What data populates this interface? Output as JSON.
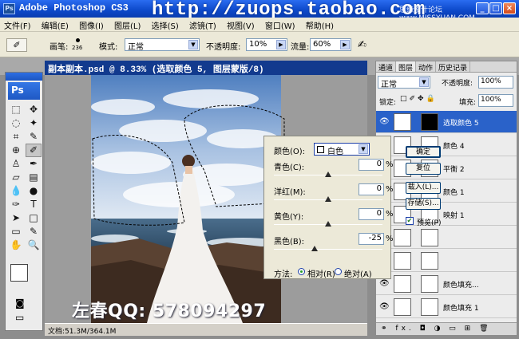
{
  "titlebar": {
    "logo": "Ps",
    "app_title": "Adobe Photoshop CS3",
    "watermark_url": "http://zuops.taobao.com",
    "watermark_small": "思缘设计论坛 www.MISSYUAN.COM",
    "min": "_",
    "max": "□",
    "close": "×"
  },
  "menu": [
    "文件(F)",
    "编辑(E)",
    "图像(I)",
    "图层(L)",
    "选择(S)",
    "滤镜(T)",
    "视图(V)",
    "窗口(W)",
    "帮助(H)"
  ],
  "options": {
    "brush_label": "画笔:",
    "brush_size": "236",
    "mode_label": "模式:",
    "mode_value": "正常",
    "opacity_label": "不透明度:",
    "opacity_value": "10%",
    "flow_label": "流量:",
    "flow_value": "60%"
  },
  "toolbox": {
    "badge": "Ps",
    "tools": [
      {
        "name": "marquee-icon",
        "glyph": "⬚"
      },
      {
        "name": "move-icon",
        "glyph": "✥"
      },
      {
        "name": "lasso-icon",
        "glyph": "◌"
      },
      {
        "name": "magic-wand-icon",
        "glyph": "✦"
      },
      {
        "name": "crop-icon",
        "glyph": "⌗"
      },
      {
        "name": "slice-icon",
        "glyph": "✎"
      },
      {
        "name": "healing-icon",
        "glyph": "⊕"
      },
      {
        "name": "brush-icon",
        "glyph": "✐",
        "active": true
      },
      {
        "name": "stamp-icon",
        "glyph": "♙"
      },
      {
        "name": "history-brush-icon",
        "glyph": "✒"
      },
      {
        "name": "eraser-icon",
        "glyph": "▱"
      },
      {
        "name": "gradient-icon",
        "glyph": "▤"
      },
      {
        "name": "blur-icon",
        "glyph": "💧"
      },
      {
        "name": "dodge-icon",
        "glyph": "●"
      },
      {
        "name": "pen-icon",
        "glyph": "✑"
      },
      {
        "name": "type-icon",
        "glyph": "T"
      },
      {
        "name": "path-select-icon",
        "glyph": "➤"
      },
      {
        "name": "shape-icon",
        "glyph": "□"
      },
      {
        "name": "notes-icon",
        "glyph": "▭"
      },
      {
        "name": "eyedropper-icon",
        "glyph": "✎"
      },
      {
        "name": "hand-icon",
        "glyph": "✋"
      },
      {
        "name": "zoom-icon",
        "glyph": "🔍"
      }
    ],
    "quickmask": "◙",
    "screenmode": "▭"
  },
  "document": {
    "title": "副本副本.psd @ 8.33% (选取颜色 5, 图层蒙版/8)",
    "status": "文档:51.3M/364.1M"
  },
  "watermark_qq": "左春QQ: 578094297",
  "dialog": {
    "colors_label": "颜色(O):",
    "colors_value": "白色",
    "sliders": [
      {
        "label": "青色(C):",
        "value": "0",
        "thumb": 0.5
      },
      {
        "label": "洋红(M):",
        "value": "0",
        "thumb": 0.5
      },
      {
        "label": "黄色(Y):",
        "value": "0",
        "thumb": 0.5
      },
      {
        "label": "黑色(B):",
        "value": "-25",
        "thumb": 0.375
      }
    ],
    "method_label": "方法:",
    "relative": "相对(R)",
    "absolute": "绝对(A)",
    "ok": "确定",
    "reset": "复位",
    "load": "载入(L)...",
    "save": "存储(S)...",
    "preview": "预览(P)"
  },
  "layers_panel": {
    "tabs": [
      "通道",
      "图层",
      "动作",
      "历史记录"
    ],
    "active_tab": 1,
    "blend_mode": "正常",
    "opacity_label": "不透明度:",
    "opacity_value": "100%",
    "lock_label": "锁定:",
    "fill_label": "填充:",
    "fill_value": "100%",
    "layers": [
      {
        "name": "选取颜色 5",
        "selected": true
      },
      {
        "name": "颜色 4",
        "selected": false
      },
      {
        "name": "平衡 2",
        "selected": false
      },
      {
        "name": "颜色 1",
        "selected": false
      },
      {
        "name": "映射 1",
        "selected": false
      },
      {
        "name": "",
        "selected": false
      },
      {
        "name": "",
        "selected": false
      },
      {
        "name": "颜色填充...",
        "selected": false
      },
      {
        "name": "颜色填充 1",
        "selected": false
      }
    ],
    "footer": "⚭ fx. ◘ ◑ ▭ ⊞ 🗑"
  }
}
